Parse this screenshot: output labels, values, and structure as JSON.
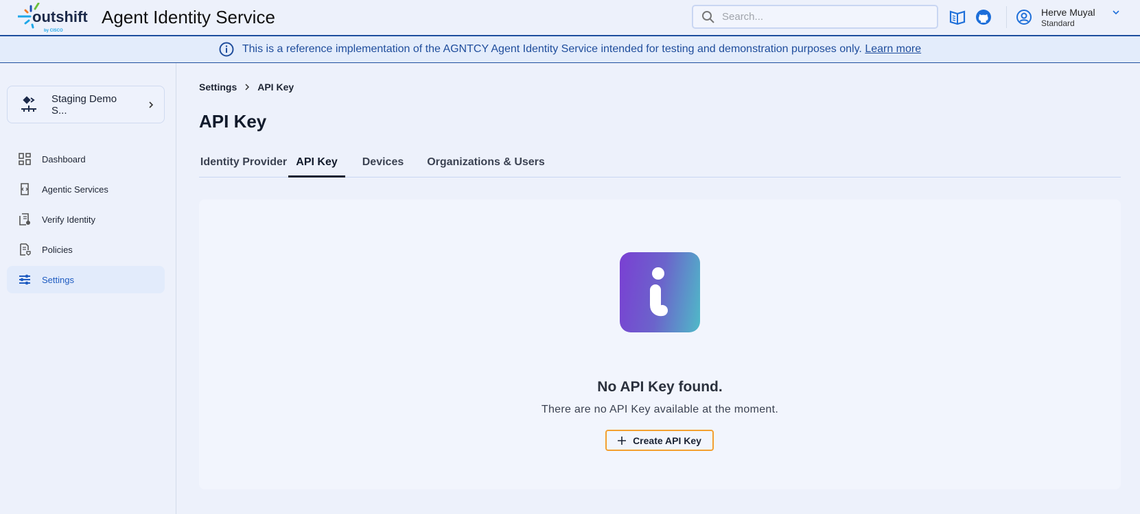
{
  "header": {
    "logo_text": "outshift",
    "logo_sub": "by CISCO",
    "app_title": "Agent Identity Service",
    "search_placeholder": "Search...",
    "user": {
      "name": "Herve Muyal",
      "plan": "Standard"
    }
  },
  "banner": {
    "text": "This is a reference implementation of the AGNTCY Agent Identity Service intended for testing and demonstration purposes only.",
    "link": "Learn more"
  },
  "sidebar": {
    "org": "Staging Demo S...",
    "items": [
      {
        "label": "Dashboard"
      },
      {
        "label": "Agentic Services"
      },
      {
        "label": "Verify Identity"
      },
      {
        "label": "Policies"
      },
      {
        "label": "Settings",
        "active": true
      }
    ]
  },
  "breadcrumb": [
    "Settings",
    "API Key"
  ],
  "page_title": "API Key",
  "tabs": [
    {
      "label": "Identity Provider"
    },
    {
      "label": "API Key",
      "active": true
    },
    {
      "label": "Devices"
    },
    {
      "label": "Organizations & Users"
    }
  ],
  "empty": {
    "title": "No API Key found.",
    "subtitle": "There are no API Key available at the moment.",
    "button": "Create API Key"
  },
  "colors": {
    "accent": "#1e6fd9",
    "button_border": "#f3a030"
  }
}
